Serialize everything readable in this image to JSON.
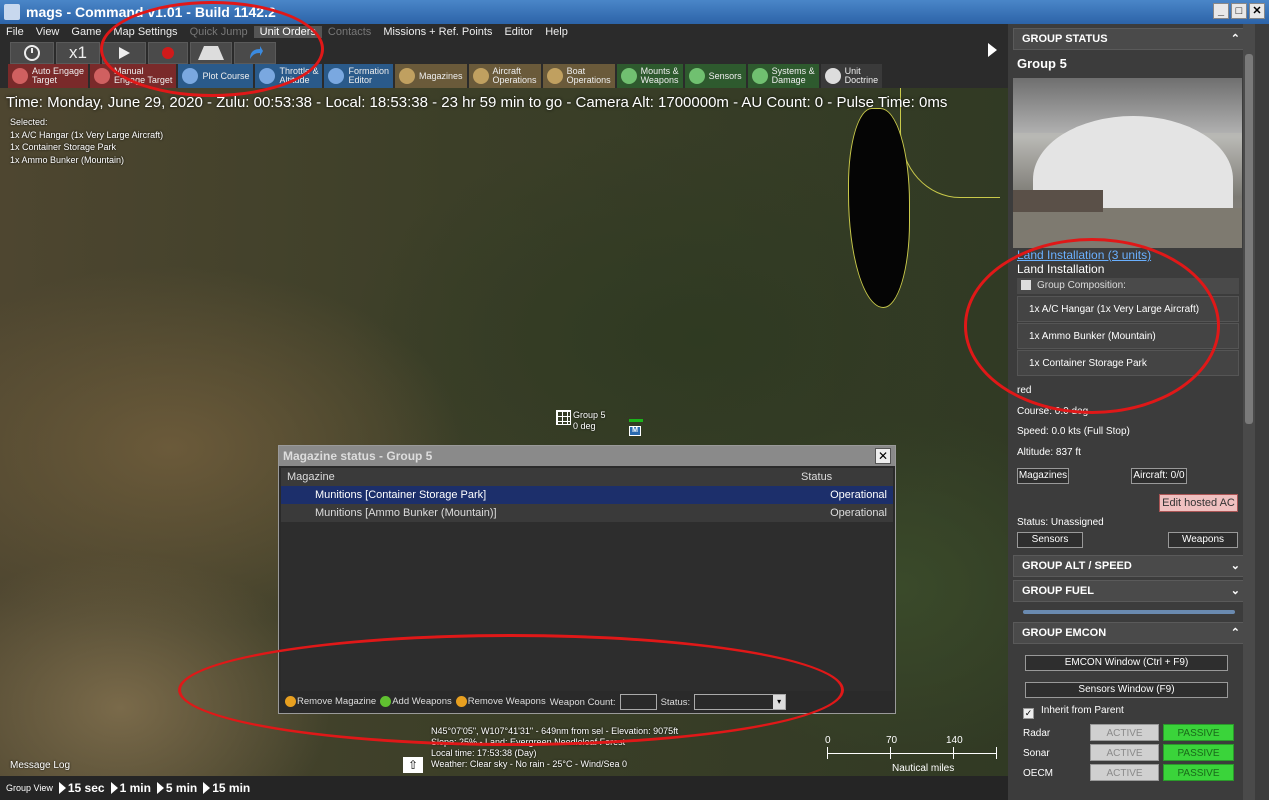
{
  "window": {
    "title": "mags - Command v1.01 - Build 1142.2",
    "min": "_",
    "max": "□",
    "close": "✕"
  },
  "menu": [
    {
      "label": "File",
      "state": "normal"
    },
    {
      "label": "View",
      "state": "normal"
    },
    {
      "label": "Game",
      "state": "normal"
    },
    {
      "label": "Map Settings",
      "state": "normal"
    },
    {
      "label": "Quick Jump",
      "state": "dim"
    },
    {
      "label": "Unit Orders",
      "state": "sel"
    },
    {
      "label": "Contacts",
      "state": "dim"
    },
    {
      "label": "Missions + Ref. Points",
      "state": "normal"
    },
    {
      "label": "Editor",
      "state": "normal"
    },
    {
      "label": "Help",
      "state": "normal"
    }
  ],
  "time_controls": {
    "compression": "x1",
    "clock_icon": "clock-icon",
    "play_icon": "play-icon",
    "record_icon": "record-icon"
  },
  "toolbar": [
    {
      "label": "Auto Engage\nTarget",
      "color": "red",
      "icon": "target-icon"
    },
    {
      "label": "Manual\nEngage Target",
      "color": "red",
      "icon": "target-icon"
    },
    {
      "label": "Plot Course",
      "color": "blue",
      "icon": "course-icon"
    },
    {
      "label": "Throttle &\nAltitude",
      "color": "blue",
      "icon": "throttle-icon"
    },
    {
      "label": "Formation\nEditor",
      "color": "blue",
      "icon": "formation-icon"
    },
    {
      "label": "Magazines",
      "color": "tan",
      "icon": "magazine-icon"
    },
    {
      "label": "Aircraft\nOperations",
      "color": "tan",
      "icon": "aircraft-icon"
    },
    {
      "label": "Boat\nOperations",
      "color": "tan",
      "icon": "boat-icon"
    },
    {
      "label": "Mounts &\nWeapons",
      "color": "green",
      "icon": "mounts-icon"
    },
    {
      "label": "Sensors",
      "color": "green",
      "icon": "sensor-icon"
    },
    {
      "label": "Systems &\nDamage",
      "color": "green",
      "icon": "systems-icon"
    },
    {
      "label": "Unit\nDoctrine",
      "color": "gray",
      "icon": "doctrine-icon"
    }
  ],
  "status_line": "Time: Monday, June 29, 2020 - Zulu: 00:53:38 - Local: 18:53:38 - 23 hr 59 min to go - Camera Alt: 1700000m - AU Count: 0 - Pulse Time: 0ms",
  "selected": [
    "Selected:",
    "1x A/C Hangar (1x Very Large Aircraft)",
    "1x Container Storage Park",
    "1x Ammo Bunker (Mountain)"
  ],
  "map_unit": {
    "name": "Group 5",
    "heading": "0 deg",
    "marker": "M"
  },
  "coords": [
    "N45°07'05\", W107°41'31\" - 649nm from sel - Elevation: 9075ft",
    "Slope: 25% - Land: Evergreen Needleleaf Forest",
    "Local time: 17:53:38 (Day)",
    "Weather: Clear sky - No rain - 25°C - Wind/Sea 0"
  ],
  "scale": {
    "ticks": [
      "0",
      "70",
      "140"
    ],
    "unit": "Nautical miles"
  },
  "message_log": "Message Log",
  "bottom": {
    "label": "Group View",
    "steps": [
      "15 sec",
      "1 min",
      "5 min",
      "15 min"
    ]
  },
  "dialog": {
    "title": "Magazine status - Group 5",
    "columns": [
      "Magazine",
      "Status"
    ],
    "rows": [
      {
        "name": "Munitions [Container Storage Park]",
        "status": "Operational",
        "selected": true
      },
      {
        "name": "Munitions [Ammo Bunker (Mountain)]",
        "status": "Operational",
        "selected": false
      }
    ],
    "footer": {
      "remove_magazine": "Remove Magazine",
      "add_weapons": "Add Weapons",
      "remove_weapons": "Remove Weapons",
      "weapon_count_label": "Weapon Count:",
      "weapon_count_value": "",
      "status_label": "Status:",
      "status_value": ""
    }
  },
  "panel": {
    "group_status_header": "GROUP STATUS",
    "group_name": "Group 5",
    "link": "Land Installation (3 units)",
    "type": "Land Installation",
    "composition_label": "Group Composition:",
    "composition": [
      "1x A/C Hangar (1x Very Large Aircraft)",
      "1x Ammo Bunker (Mountain)",
      "1x Container Storage Park"
    ],
    "side": "red",
    "course": "Course: 0.0 deg",
    "speed": "Speed: 0.0 kts (Full Stop)",
    "altitude": "Altitude: 837 ft",
    "magazines_btn": "Magazines",
    "aircraft_btn": "Aircraft: 0/0",
    "edit_hosted_btn": "Edit hosted AC",
    "status": "Status: Unassigned",
    "sensors_btn": "Sensors",
    "weapons_btn": "Weapons",
    "alt_speed_header": "GROUP ALT / SPEED",
    "fuel_header": "GROUP FUEL",
    "emcon_header": "GROUP EMCON",
    "emcon_window_btn": "EMCON Window (Ctrl + F9)",
    "sensors_window_btn": "Sensors Window (F9)",
    "inherit_label": "Inherit from Parent",
    "emcon_rows": [
      {
        "label": "Radar",
        "active": "ACTIVE",
        "passive": "PASSIVE"
      },
      {
        "label": "Sonar",
        "active": "ACTIVE",
        "passive": "PASSIVE"
      },
      {
        "label": "OECM",
        "active": "ACTIVE",
        "passive": "PASSIVE"
      }
    ]
  },
  "colors": {
    "annotation": "#e01818",
    "passive_on": "#3ad43a",
    "selection": "#1c2f6b"
  }
}
